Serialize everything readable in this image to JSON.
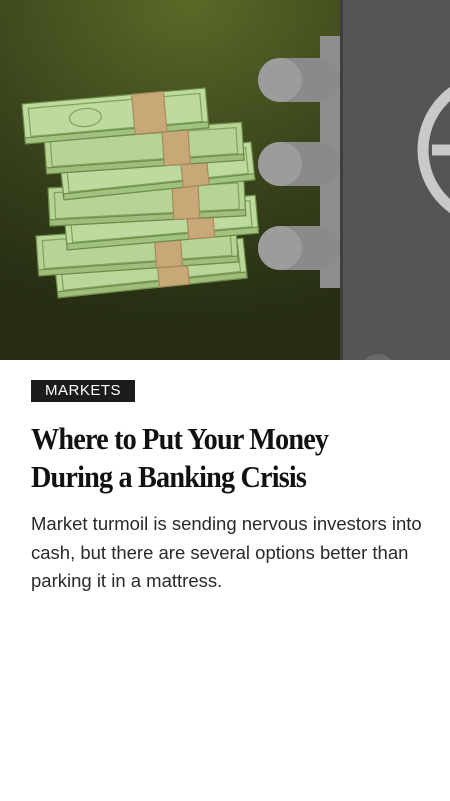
{
  "article": {
    "section": "MARKETS",
    "headline_line1": "Where to Put Your Money",
    "headline_line2": "During a Banking Crisis",
    "dek": "Market turmoil is sending nervous investors into cash, but there are several options better than parking it in a mattress."
  },
  "colors": {
    "background": "#ffffff",
    "tag_background": "#1c1c1c",
    "hero_background": "#2b3316",
    "safe_gray": "#555555",
    "bill_green": "#b5d495",
    "band_tan": "#c9a878"
  },
  "illustration": {
    "subject": "money-stack-and-safe-icon"
  }
}
